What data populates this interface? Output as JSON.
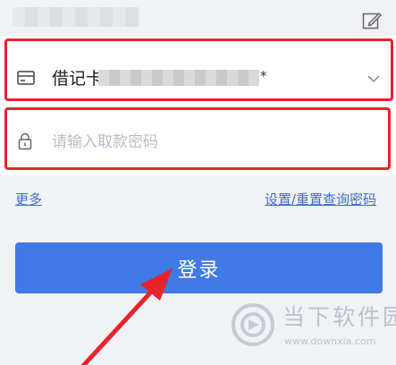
{
  "header": {
    "edit_icon": "edit-icon"
  },
  "card_select": {
    "icon": "card-icon",
    "label": "借记卡",
    "masked_suffix": "*",
    "dropdown_icon": "chevron-down-icon"
  },
  "password": {
    "icon": "lock-icon",
    "placeholder": "请输入取款密码",
    "value": ""
  },
  "links": {
    "more": "更多",
    "reset_password": "设置/重置查询密码"
  },
  "login_button": {
    "label": "登录"
  },
  "annotation": {
    "highlight_color": "#e8232a"
  },
  "watermark": {
    "title": "当下软件园",
    "url": "www.downxia.com"
  },
  "colors": {
    "accent": "#3f7ae6",
    "link": "#3c6fcf",
    "background": "#f1f2f6"
  }
}
